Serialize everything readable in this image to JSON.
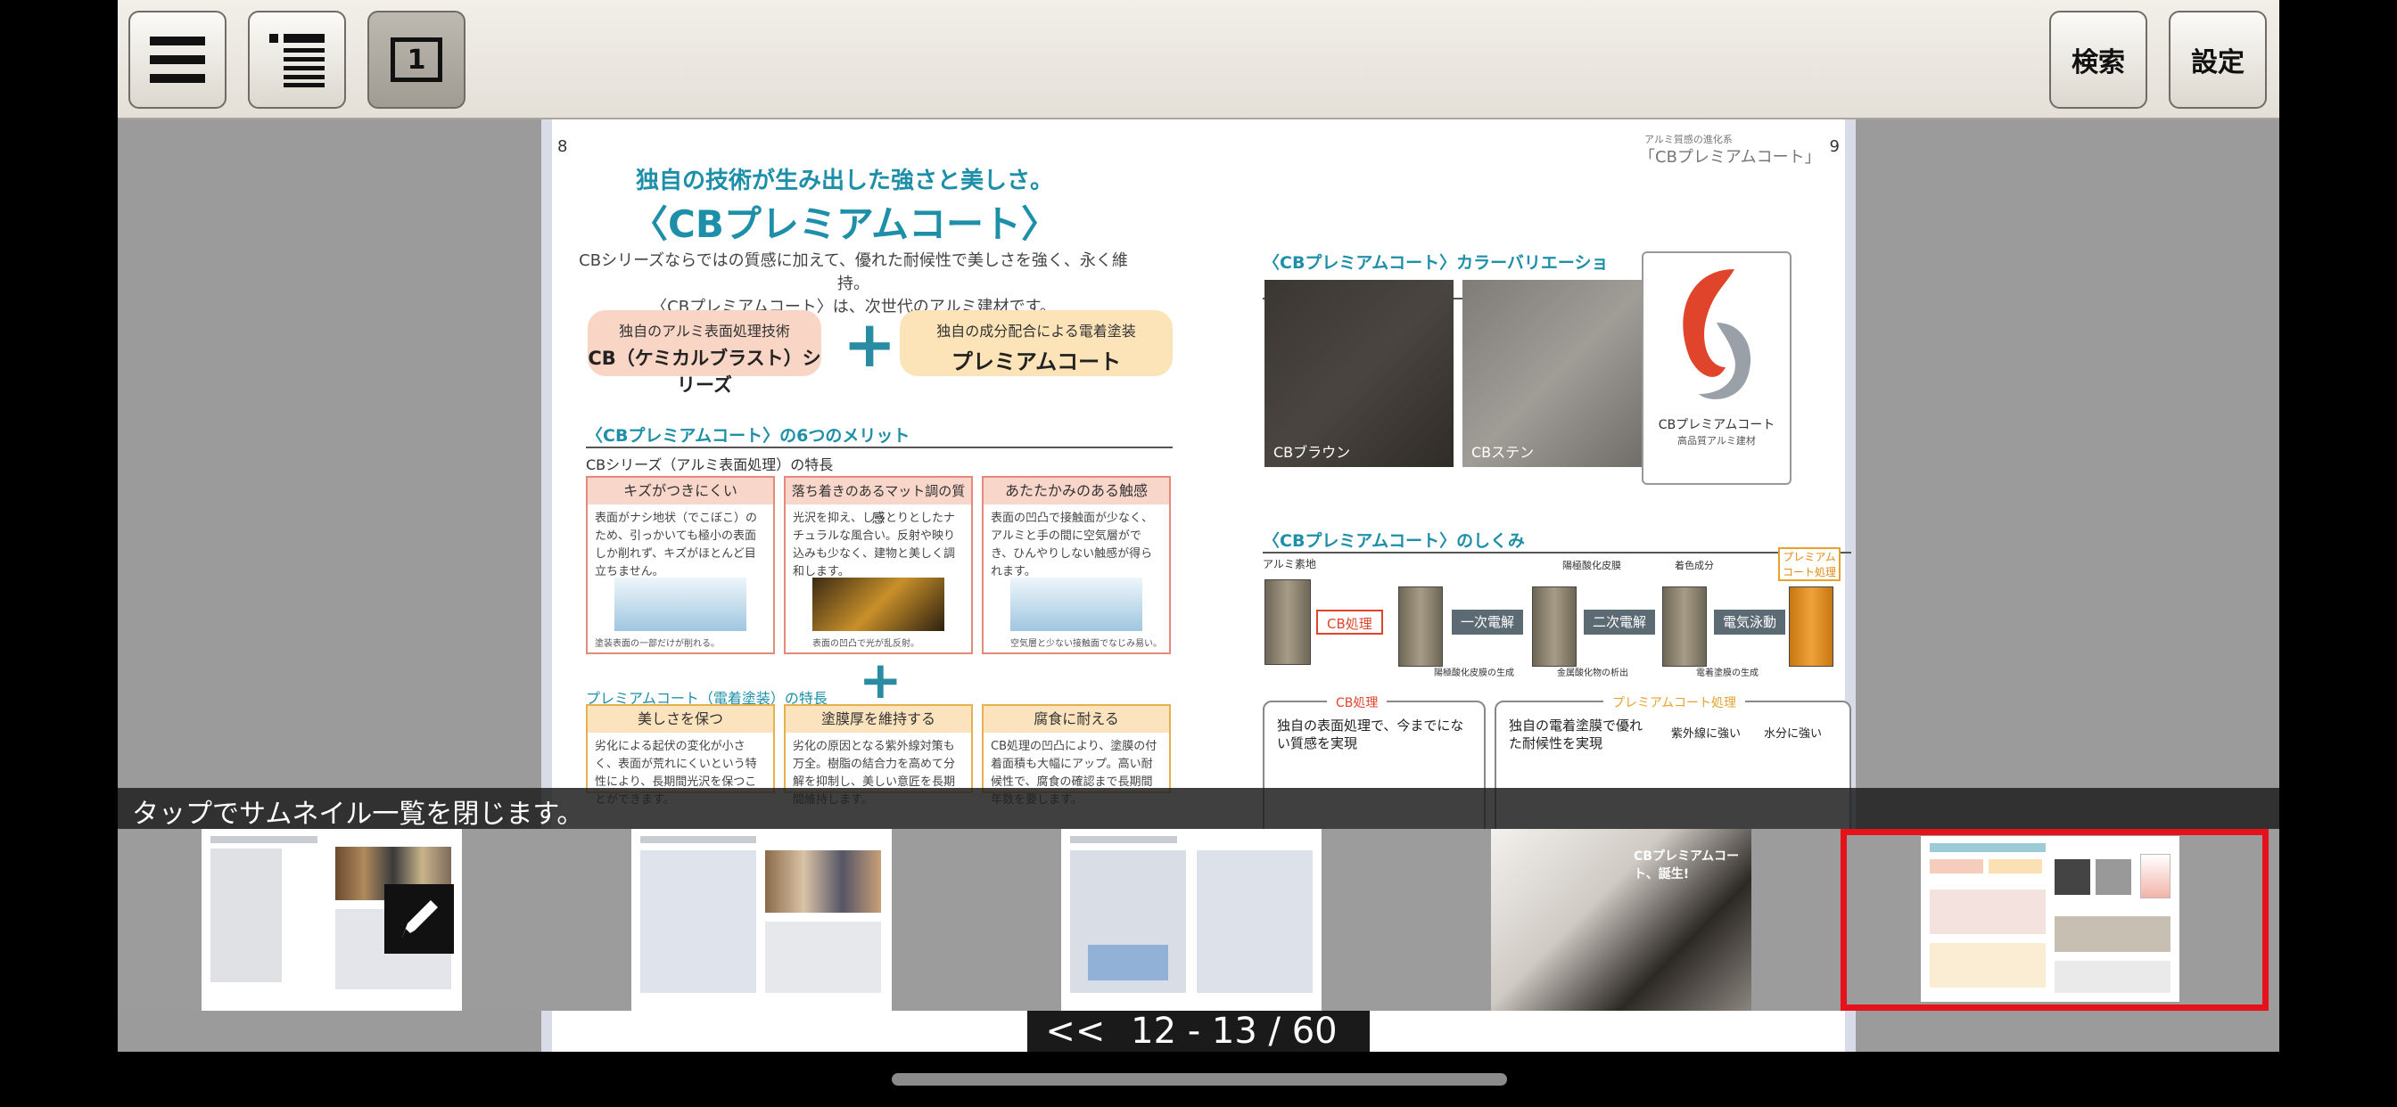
{
  "toolbar": {
    "menu_icon": "hamburger-menu-icon",
    "list_icon": "list-view-icon",
    "single_page_icon": "single-page-icon",
    "single_page_label": "1",
    "search_label": "検索",
    "settings_label": "設定"
  },
  "spread": {
    "left_page_number": "8",
    "right_page_number": "9",
    "right_header_small": "アルミ質感の進化系",
    "right_header_title": "「CBプレミアムコート」",
    "headline_small": "独自の技術が生み出した強さと美しさ。",
    "headline_big": "〈CBプレミアムコート〉",
    "intro_line1": "CBシリーズならではの質感に加えて、優れた耐候性で美しさを強く、永く維持。",
    "intro_line2": "〈CBプレミアムコート〉は、次世代のアルミ建材です。",
    "pill_left_small": "独自のアルミ表面処理技術",
    "pill_left_big": "CB（ケミカルブラスト）シリーズ",
    "pill_right_small": "独自の成分配合による電着塗装",
    "pill_right_big": "プレミアムコート",
    "merits_title": "〈CBプレミアムコート〉の6つのメリット",
    "cb_features_label": "CBシリーズ（アルミ表面処理）の特長",
    "cards_top": [
      {
        "title": "キズがつきにくい",
        "body": "表面がナシ地状（でこぼこ）のため、引っかいても極小の表面しか削れず、キズがほとんど目立ちません。",
        "caption": "塗装表面の一部だけが削れる。"
      },
      {
        "title": "落ち着きのあるマット調の質感",
        "body": "光沢を抑え、しっとりとしたナチュラルな風合い。反射や映り込みも少なく、建物と美しく調和します。",
        "caption": "表面の凹凸で光が乱反射。"
      },
      {
        "title": "あたたかみのある触感",
        "body": "表面の凹凸で接触面が少なく、アルミと手の間に空気層ができ、ひんやりしない触感が得られます。",
        "caption": "空気層と少ない接触面でなじみ易い。"
      }
    ],
    "premium_features_label": "プレミアムコート（電着塗装）の特長",
    "cards_bottom": [
      {
        "title": "美しさを保つ",
        "body": "劣化による起伏の変化が小さく、表面が荒れにくいという特性により、長期間光沢を保つことができます。"
      },
      {
        "title": "塗膜厚を維持する",
        "body": "劣化の原因となる紫外線対策も万全。樹脂の結合力を高めて分解を抑制し、美しい意匠を長期間維持します。"
      },
      {
        "title": "腐食に耐える",
        "body": "CB処理の凹凸により、塗膜の付着面積も大幅にアップ。高い耐候性で、腐食の確認まで長期間年数を要します。"
      }
    ],
    "color_variation_title": "〈CBプレミアムコート〉カラーバリエーション",
    "swatches": [
      {
        "name": "CBブラウン",
        "color": "#403b36"
      },
      {
        "name": "CBステン",
        "color": "#8f8b86"
      }
    ],
    "logo_text": "CBプレミアムコート",
    "logo_sub": "高品質アルミ建材",
    "mechanism_title": "〈CBプレミアムコート〉のしくみ",
    "mechanism_labels": {
      "aluminum": "アルミ素地",
      "cb_process": "CB処理",
      "oxide_film": "陽極酸化皮膜",
      "coloring": "着色成分",
      "premium_process": "プレミアムコート処理",
      "step1": "一次電解",
      "step2": "二次電解",
      "step3": "電気泳動",
      "oxide_generation": "陽極酸化皮膜の生成",
      "metal_deposit": "金属酸化物の析出",
      "electro_coating": "電着塗膜の生成"
    },
    "panel_left_title": "CB処理",
    "panel_left_heading": "独自の表面処理で、今までにない質感を実現",
    "panel_right_title": "プレミアムコート処理",
    "panel_right_heading": "独自の電着塗膜で優れた耐候性を実現",
    "panel_right_col1": "紫外線に強い",
    "panel_right_col2": "水分に強い"
  },
  "hint_text": "タップでサムネイル一覧を閉じます。",
  "thumbnails": [
    {
      "label": "page-thumb-1"
    },
    {
      "label": "page-thumb-2"
    },
    {
      "label": "page-thumb-3"
    },
    {
      "label": "CBプレミアムコート、誕生!"
    },
    {
      "label": "page-thumb-5",
      "selected": true
    }
  ],
  "pager": {
    "prev": "<<",
    "current": "12 - 13 / 60",
    "next": ">>"
  },
  "colors": {
    "accent_teal": "#1e8fa8",
    "selection_red": "#e6121b"
  }
}
